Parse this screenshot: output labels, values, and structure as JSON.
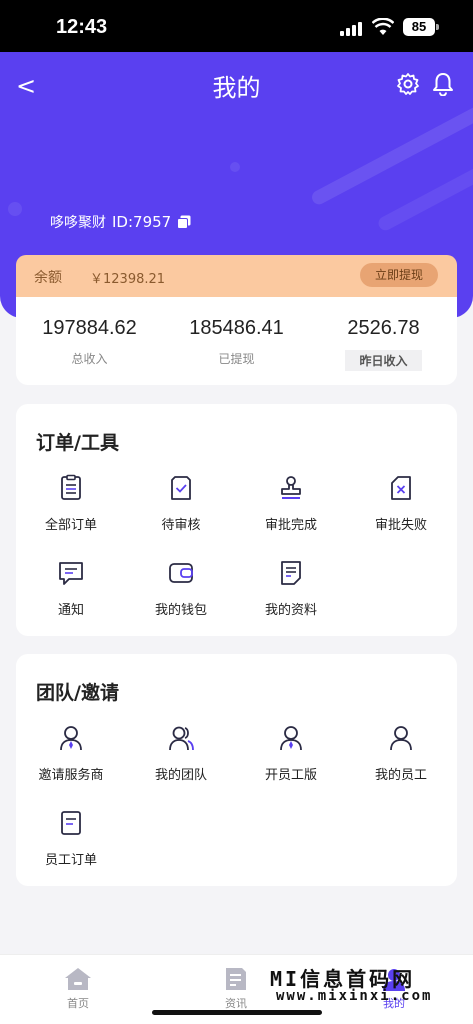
{
  "status_bar": {
    "time": "12:43",
    "battery": "85"
  },
  "header": {
    "back": "<",
    "title": "我的",
    "username": "哆哆聚财",
    "user_id": "ID:7957"
  },
  "balance": {
    "label": "余额",
    "amount": "￥12398.21",
    "withdraw_label": "立即提现"
  },
  "stats": [
    {
      "value": "197884.62",
      "caption": "总收入"
    },
    {
      "value": "185486.41",
      "caption": "已提现"
    },
    {
      "value": "2526.78",
      "caption": "昨日收入"
    }
  ],
  "orders": {
    "title": "订单/工具",
    "items": [
      {
        "label": "全部订单",
        "icon": "list-icon"
      },
      {
        "label": "待审核",
        "icon": "pending-review-icon"
      },
      {
        "label": "审批完成",
        "icon": "stamp-icon"
      },
      {
        "label": "审批失败",
        "icon": "rejected-icon"
      },
      {
        "label": "通知",
        "icon": "message-icon"
      },
      {
        "label": "我的钱包",
        "icon": "wallet-icon"
      },
      {
        "label": "我的资料",
        "icon": "document-icon"
      }
    ]
  },
  "team": {
    "title": "团队/邀请",
    "items": [
      {
        "label": "邀请服务商",
        "icon": "user-tie-icon"
      },
      {
        "label": "我的团队",
        "icon": "team-icon"
      },
      {
        "label": "开员工版",
        "icon": "user-tie-icon"
      },
      {
        "label": "我的员工",
        "icon": "user-icon"
      },
      {
        "label": "员工订单",
        "icon": "document-icon"
      }
    ]
  },
  "tabbar": [
    {
      "label": "首页",
      "icon": "home-icon"
    },
    {
      "label": "资讯",
      "icon": "news-icon"
    },
    {
      "label": "我的",
      "icon": "profile-icon"
    }
  ],
  "watermark": {
    "line1": "MI信息首码网",
    "line2": "www.mixinxi.com"
  },
  "colors": {
    "primary": "#5a40f0",
    "balance_bg": "#fbc9a0",
    "withdraw_bg": "#e8a473"
  }
}
